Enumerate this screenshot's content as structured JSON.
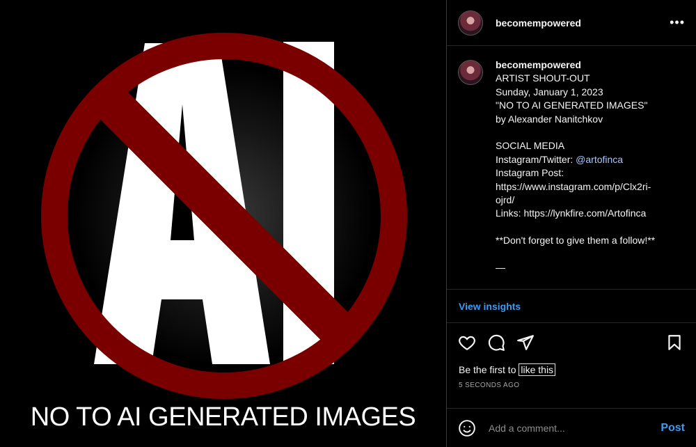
{
  "media": {
    "logo_text": "AI",
    "caption": "NO TO AI GENERATED IMAGES",
    "colors": {
      "ring": "#7a0000",
      "letters": "#ffffff"
    }
  },
  "header": {
    "username": "becomempowered",
    "more_icon": "more-horizontal-icon"
  },
  "post": {
    "username": "becomempowered",
    "lines_top": [
      "ARTIST SHOUT-OUT",
      "Sunday, January 1, 2023",
      "\"NO TO AI GENERATED IMAGES\"",
      "by Alexander Nanitchkov",
      "",
      "SOCIAL MEDIA"
    ],
    "mention_prefix": "Instagram/Twitter: ",
    "mention": "@artofinca",
    "lines_bottom": [
      "Instagram Post:",
      "https://www.instagram.com/p/Clx2ri-",
      "ojrd/",
      "Links: https://lynkfire.com/Artofinca",
      "",
      "**Don't forget to give them a follow!**",
      "",
      "—"
    ]
  },
  "insights": {
    "label": "View insights"
  },
  "actions": {
    "icons": [
      "heart-icon",
      "comment-icon",
      "share-icon",
      "bookmark-icon"
    ]
  },
  "likes": {
    "prefix": "Be the first to ",
    "link": "like this"
  },
  "timestamp": "5 SECONDS AGO",
  "comment": {
    "placeholder": "Add a comment...",
    "post_label": "Post",
    "emoji_icon": "emoji-icon"
  },
  "colors": {
    "accent": "#3f9bf0",
    "mention": "#a9c8ff"
  }
}
